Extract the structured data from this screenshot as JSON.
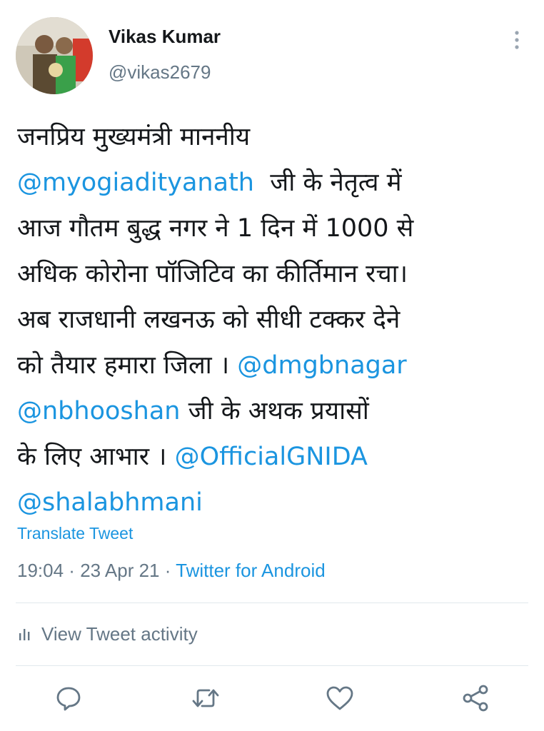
{
  "user": {
    "display_name": "Vikas Kumar",
    "handle": "@vikas2679"
  },
  "tweet": {
    "lines": [
      [
        "जनप्रिय मुख्यमंत्री माननीय"
      ],
      [
        "@myogiadityanath",
        "  जी के नेतृत्व में"
      ],
      [
        "आज गौतम बुद्ध नगर ने 1 दिन में 1000 से"
      ],
      [
        "अधिक कोरोना पॉजिटिव का कीर्तिमान रचा।"
      ],
      [
        "अब राजधानी लखनऊ को सीधी टक्कर देने"
      ],
      [
        "को तैयार हमारा जिला । ",
        "@dmgbnagar"
      ],
      [
        "@nbhooshan",
        " जी के अथक प्रयासों"
      ],
      [
        "के लिए आभार । ",
        "@OfficialGNIDA"
      ],
      [
        "@shalabhmani"
      ]
    ]
  },
  "translate_label": "Translate Tweet",
  "meta": {
    "time": "19:04",
    "separator": " · ",
    "date": "23 Apr 21",
    "source": "Twitter for Android"
  },
  "activity_label": "View Tweet activity",
  "actions": {
    "reply_icon": "speech-bubble-icon",
    "retweet_icon": "retweet-arrows-icon",
    "like_icon": "heart-icon",
    "share_icon": "share-nodes-icon"
  },
  "colors": {
    "link": "#1b95e0",
    "text": "#14171a",
    "secondary": "#657786",
    "divider": "#e1e8ed"
  }
}
